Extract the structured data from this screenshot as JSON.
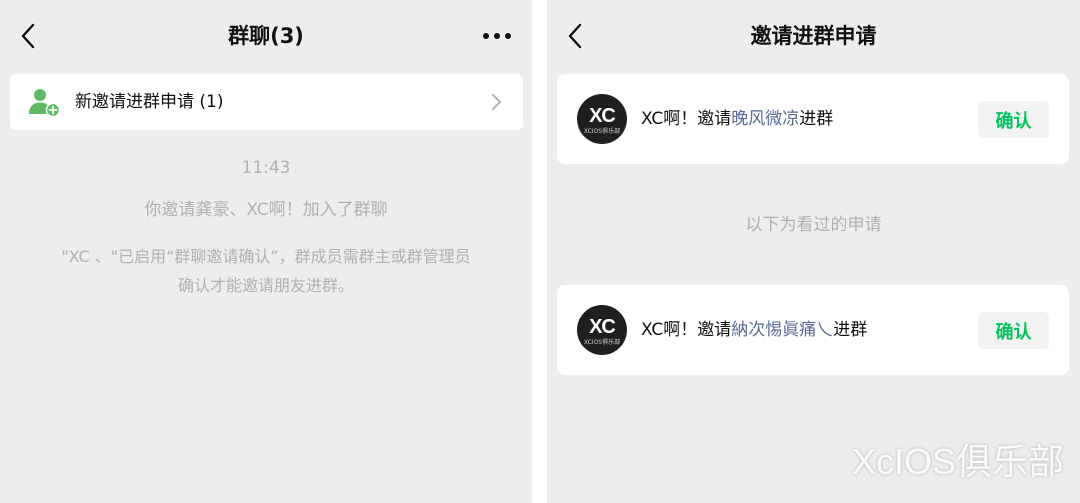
{
  "left": {
    "nav": {
      "title": "群聊(3)"
    },
    "invite_row": {
      "label": "新邀请进群申请 (1)"
    },
    "messages": {
      "time": "11:43",
      "joined": "你邀请龚豪、XC啊！加入了群聊",
      "notice_line1": "\"XC 、\"已启用“群聊邀请确认”，群成员需群主或群管理员",
      "notice_line2": "确认才能邀请朋友进群。"
    }
  },
  "right": {
    "nav": {
      "title": "邀请进群申请"
    },
    "requests": [
      {
        "inviter": "XC啊！",
        "verb": "邀请",
        "invitee": "晚风微凉",
        "suffix": "进群",
        "confirm_label": "确认",
        "avatar_text": "XC",
        "avatar_sub": "XCIOS俱乐部"
      },
      {
        "inviter": "XC啊！",
        "verb": "邀请",
        "invitee": "納次惕眞痛乀",
        "suffix": "进群",
        "confirm_label": "确认",
        "avatar_text": "XC",
        "avatar_sub": "XCIOS俱乐部"
      }
    ],
    "divider": "以下为看过的申请"
  },
  "watermark": "XcIOS俱乐部",
  "colors": {
    "accent": "#07c160",
    "link": "#576b95",
    "background": "#ededed"
  }
}
